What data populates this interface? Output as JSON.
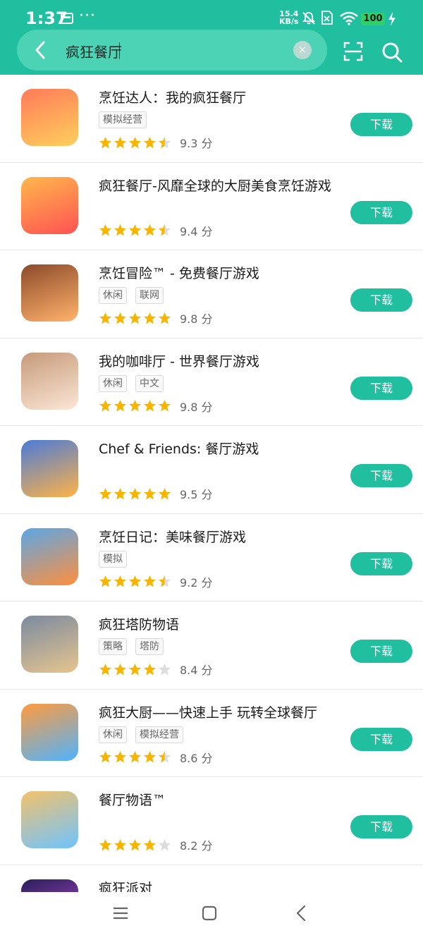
{
  "status_bar": {
    "time": "1:37",
    "net_speed_value": "15.4",
    "net_speed_unit": "KB/s",
    "battery": "100"
  },
  "search": {
    "query": "疯狂餐厅"
  },
  "colors": {
    "accent": "#1fbfa0",
    "star_filled": "#f7b500",
    "star_empty": "#dddddd"
  },
  "apps": [
    {
      "title": "烹饪达人：我的疯狂餐厅",
      "tags": [
        "模拟经营"
      ],
      "stars": 4.5,
      "score": "9.3 分",
      "button": "下载"
    },
    {
      "title": "疯狂餐厅-风靡全球的大厨美食烹饪游戏",
      "tags": [],
      "stars": 4.5,
      "score": "9.4 分",
      "button": "下载"
    },
    {
      "title": "烹饪冒险™ - 免费餐厅游戏",
      "tags": [
        "休闲",
        "联网"
      ],
      "stars": 5,
      "score": "9.8 分",
      "button": "下载"
    },
    {
      "title": "我的咖啡厅 - 世界餐厅游戏",
      "tags": [
        "休闲",
        "中文"
      ],
      "stars": 5,
      "score": "9.8 分",
      "button": "下载"
    },
    {
      "title": "Chef & Friends: 餐厅游戏",
      "tags": [],
      "stars": 5,
      "score": "9.5 分",
      "button": "下载"
    },
    {
      "title": "烹饪日记：美味餐厅游戏",
      "tags": [
        "模拟"
      ],
      "stars": 4.5,
      "score": "9.2 分",
      "button": "下载"
    },
    {
      "title": "疯狂塔防物语",
      "tags": [
        "策略",
        "塔防"
      ],
      "stars": 4,
      "score": "8.4 分",
      "button": "下载"
    },
    {
      "title": "疯狂大厨——快速上手 玩转全球餐厅",
      "tags": [
        "休闲",
        "模拟经营"
      ],
      "stars": 4.5,
      "score": "8.6 分",
      "button": "下载"
    },
    {
      "title": "餐厅物语™",
      "tags": [],
      "stars": 4,
      "score": "8.2 分",
      "button": "下载"
    },
    {
      "title": "疯狂派对",
      "tags": [],
      "stars": null,
      "score": "",
      "button": ""
    }
  ]
}
